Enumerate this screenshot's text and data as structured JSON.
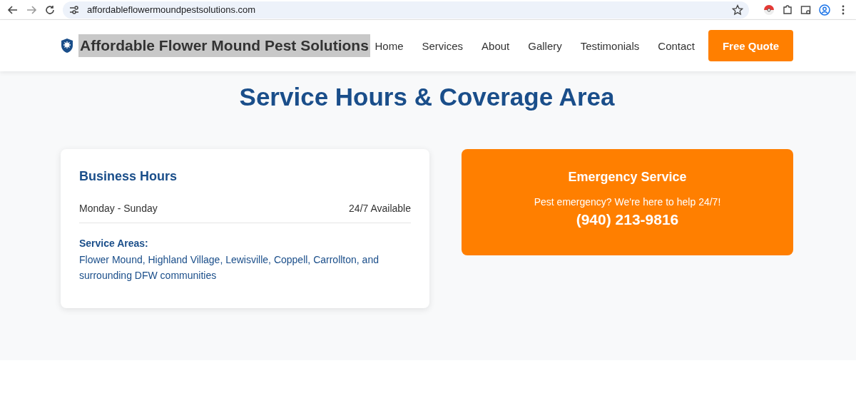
{
  "browser": {
    "url": "affordableflowermoundpestsolutions.com"
  },
  "header": {
    "brand": "Affordable Flower Mound Pest Solutions",
    "brand_text_selected": true,
    "nav": [
      {
        "label": "Home"
      },
      {
        "label": "Services"
      },
      {
        "label": "About"
      },
      {
        "label": "Gallery"
      },
      {
        "label": "Testimonials"
      },
      {
        "label": "Contact"
      }
    ],
    "cta": "Free Quote"
  },
  "section": {
    "title": "Service Hours & Coverage Area",
    "hours_card": {
      "title": "Business Hours",
      "rows": [
        {
          "day": "Monday - Sunday",
          "hours": "24/7 Available"
        }
      ],
      "areas_label": "Service Areas:",
      "areas": "Flower Mound, Highland Village, Lewisville, Coppell, Carrollton, and surrounding DFW communities"
    },
    "emergency_card": {
      "title": "Emergency Service",
      "text": "Pest emergency? We're here to help 24/7!",
      "phone": "(940) 213-9816"
    }
  }
}
